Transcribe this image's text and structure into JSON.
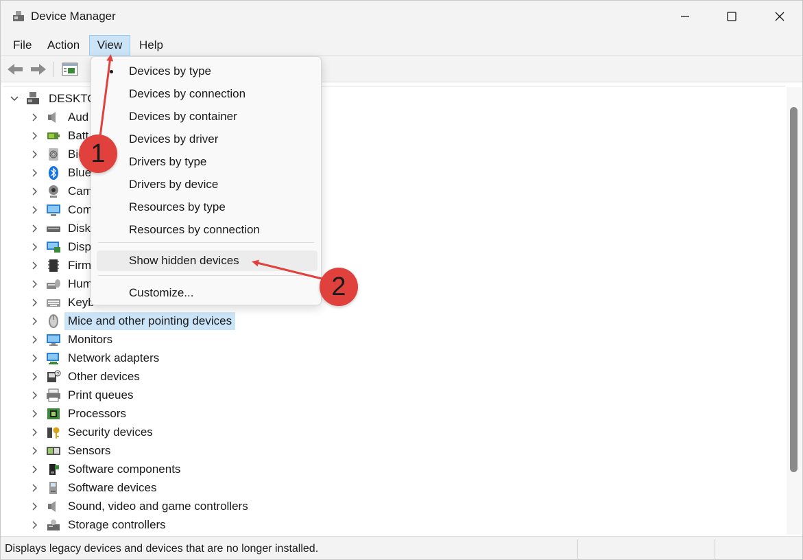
{
  "window": {
    "title": "Device Manager",
    "controls": [
      "minimize",
      "maximize",
      "close"
    ]
  },
  "menubar": {
    "items": [
      "File",
      "Action",
      "View",
      "Help"
    ]
  },
  "toolbar": {
    "buttons": [
      "back-arrow-icon",
      "forward-arrow-icon",
      "properties-icon"
    ]
  },
  "tree": {
    "root": "DESKTO",
    "categories": [
      {
        "label": "Aud",
        "icon": "speaker-icon"
      },
      {
        "label": "Batt",
        "icon": "battery-icon"
      },
      {
        "label": "Bio",
        "icon": "fingerprint-icon"
      },
      {
        "label": "Blue",
        "icon": "bluetooth-icon"
      },
      {
        "label": "Cam",
        "icon": "webcam-icon"
      },
      {
        "label": "Com",
        "icon": "computer-icon"
      },
      {
        "label": "Disk",
        "icon": "disk-icon"
      },
      {
        "label": "Disp",
        "icon": "display-adapter-icon"
      },
      {
        "label": "Firm",
        "icon": "firmware-icon"
      },
      {
        "label": "Hum",
        "icon": "hid-icon"
      },
      {
        "label": "Keyb",
        "icon": "keyboard-icon"
      },
      {
        "label": "Mice and other pointing devices",
        "icon": "mouse-icon",
        "selected": true
      },
      {
        "label": "Monitors",
        "icon": "monitor-icon"
      },
      {
        "label": "Network adapters",
        "icon": "network-icon"
      },
      {
        "label": "Other devices",
        "icon": "unknown-device-icon"
      },
      {
        "label": "Print queues",
        "icon": "printer-icon"
      },
      {
        "label": "Processors",
        "icon": "cpu-icon"
      },
      {
        "label": "Security devices",
        "icon": "security-key-icon"
      },
      {
        "label": "Sensors",
        "icon": "sensor-icon"
      },
      {
        "label": "Software components",
        "icon": "software-component-icon"
      },
      {
        "label": "Software devices",
        "icon": "software-device-icon"
      },
      {
        "label": "Sound, video and game controllers",
        "icon": "speaker-icon"
      },
      {
        "label": "Storage controllers",
        "icon": "storage-controller-icon"
      }
    ]
  },
  "view_menu": {
    "items": [
      {
        "label": "Devices by type",
        "checked": true
      },
      {
        "label": "Devices by connection"
      },
      {
        "label": "Devices by container"
      },
      {
        "label": "Devices by driver"
      },
      {
        "label": "Drivers by type"
      },
      {
        "label": "Drivers by device"
      },
      {
        "label": "Resources by type"
      },
      {
        "label": "Resources by connection"
      }
    ],
    "show_hidden": "Show hidden devices",
    "customize": "Customize..."
  },
  "status": {
    "text": "Displays legacy devices and devices that are no longer installed."
  },
  "annotations": {
    "badge1": "1",
    "badge2": "2",
    "color": "#e0413c"
  }
}
